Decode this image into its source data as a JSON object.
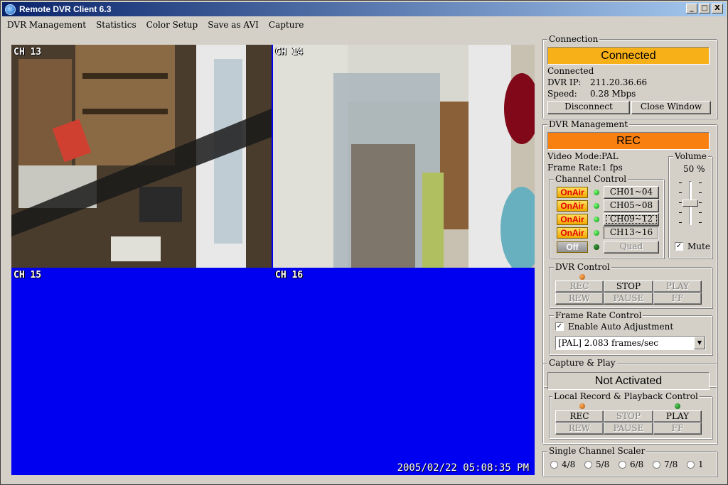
{
  "window": {
    "title": "Remote DVR Client 6.3",
    "minimize": "_",
    "maximize": "□",
    "close": "X"
  },
  "menu": [
    "DVR Management",
    "Statistics",
    "Color Setup",
    "Save as AVI",
    "Capture"
  ],
  "video": {
    "cameras": [
      "CH 13",
      "CH 14",
      "CH 15",
      "CH 16"
    ],
    "timestamp": "2005/02/22  05:08:35 PM",
    "background_color": "#0000f0"
  },
  "connection": {
    "legend": "Connection",
    "status": "Connected",
    "status_color": "#f8b018",
    "state_text": "Connected",
    "ip_label": "DVR IP:",
    "ip_value": "211.20.36.66",
    "speed_label": "Speed:",
    "speed_value": "0.28 Mbps",
    "disconnect": "Disconnect",
    "close_window": "Close Window"
  },
  "dvr_management": {
    "legend": "DVR Management",
    "status": "REC",
    "status_color": "#f88010",
    "video_mode_label": "Video Mode:",
    "video_mode_value": "PAL",
    "frame_rate_label": "Frame Rate:",
    "frame_rate_value": "1 fps",
    "volume": {
      "legend": "Volume",
      "value": "50 %",
      "level": 0.5,
      "mute_label": "Mute",
      "mute_checked": true
    },
    "channel_control": {
      "legend": "Channel Control",
      "rows": [
        {
          "state": "OnAir",
          "led": "green",
          "button": "CH01~04"
        },
        {
          "state": "OnAir",
          "led": "green",
          "button": "CH05~08"
        },
        {
          "state": "OnAir",
          "led": "green",
          "button": "CH09~12"
        },
        {
          "state": "OnAir",
          "led": "green",
          "button": "CH13~16"
        },
        {
          "state": "Off",
          "led": "dkgreen",
          "button": "Quad"
        }
      ]
    },
    "dvr_control": {
      "legend": "DVR Control",
      "rec": "REC",
      "stop": "STOP",
      "play": "PLAY",
      "rew": "REW",
      "pause": "PAUSE",
      "ff": "FF"
    },
    "frame_rate_control": {
      "legend": "Frame Rate Control",
      "auto_label": "Enable Auto Adjustment",
      "auto_checked": true,
      "selected": "[PAL]  2.083 frames/sec"
    }
  },
  "capture_play": {
    "legend": "Capture & Play",
    "status": "Not Activated",
    "local": {
      "legend": "Local Record & Playback Control",
      "rec": "REC",
      "stop": "STOP",
      "play": "PLAY",
      "rew": "REW",
      "pause": "PAUSE",
      "ff": "FF"
    }
  },
  "scaler": {
    "legend": "Single Channel Scaler",
    "options": [
      "4/8",
      "5/8",
      "6/8",
      "7/8",
      "1"
    ]
  }
}
